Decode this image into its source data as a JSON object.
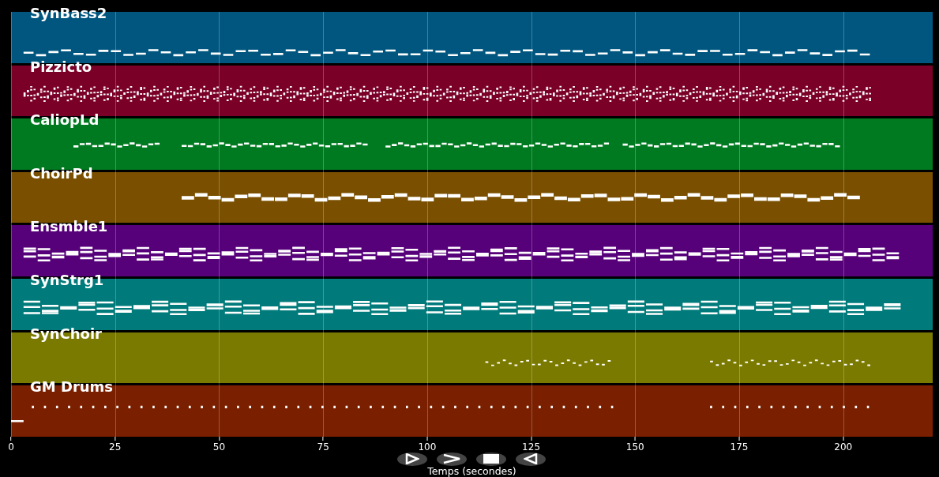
{
  "tracks": [
    {
      "name": "SynBass2",
      "color": "#00567f"
    },
    {
      "name": "Pizzicto",
      "color": "#7a0028"
    },
    {
      "name": "CaliopLd",
      "color": "#007a20"
    },
    {
      "name": "ChoirPd",
      "color": "#7a5000"
    },
    {
      "name": "Ensmble1",
      "color": "#56007a"
    },
    {
      "name": "SynStrg1",
      "color": "#007a7a"
    },
    {
      "name": "SynChoir",
      "color": "#7a7a00"
    },
    {
      "name": "GM Drums",
      "color": "#7a2000"
    }
  ],
  "x_axis": {
    "label": "Temps (secondes)",
    "ticks": [
      "0",
      "25",
      "50",
      "75",
      "100",
      "125",
      "150",
      "175",
      "200"
    ]
  }
}
